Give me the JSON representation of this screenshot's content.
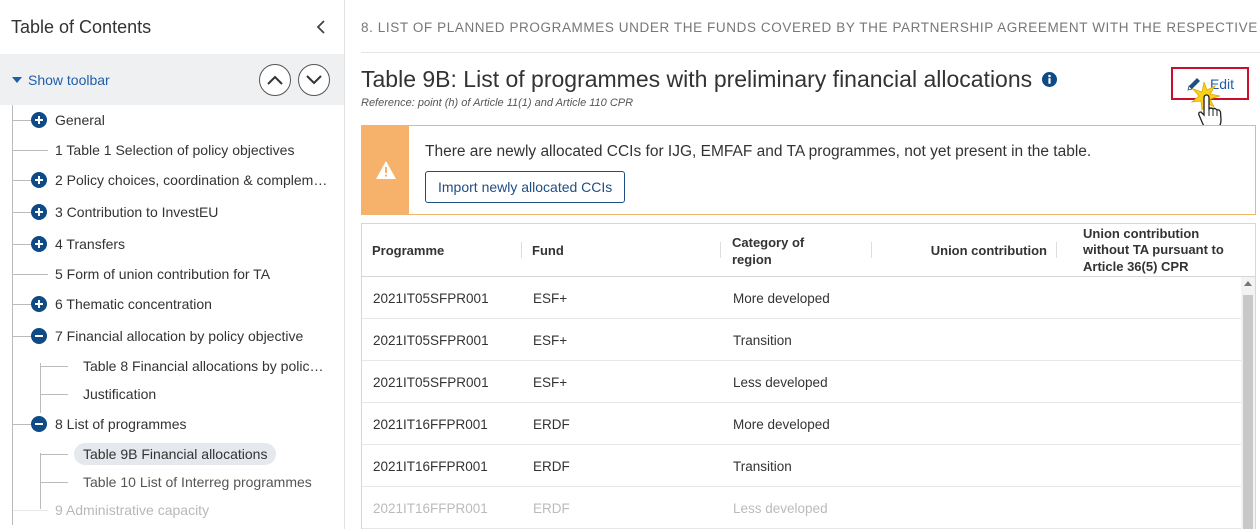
{
  "sidebar": {
    "title": "Table of Contents",
    "show_toolbar": "Show toolbar",
    "items": [
      {
        "label": "General",
        "icon": "plus"
      },
      {
        "label": "1 Table 1 Selection of policy objectives",
        "icon": "none"
      },
      {
        "label": "2 Policy choices, coordination & complem…",
        "icon": "plus"
      },
      {
        "label": "3 Contribution to InvestEU",
        "icon": "plus"
      },
      {
        "label": "4 Transfers",
        "icon": "plus"
      },
      {
        "label": "5 Form of union contribution for TA",
        "icon": "none"
      },
      {
        "label": "6 Thematic concentration",
        "icon": "plus"
      },
      {
        "label": "7 Financial allocation by policy objective",
        "icon": "minus"
      },
      {
        "label": "Table 8 Financial allocations by polic…",
        "icon": "none",
        "child": true
      },
      {
        "label": "Justification",
        "icon": "none",
        "child": true
      },
      {
        "label": "8 List of programmes",
        "icon": "minus"
      },
      {
        "label": "Table 9B Financial allocations",
        "icon": "none",
        "child": true,
        "selected": true
      },
      {
        "label": "Table 10 List of Interreg programmes",
        "icon": "none",
        "child": true
      },
      {
        "label": "9 Administrative capacity",
        "icon": "none"
      }
    ]
  },
  "main": {
    "breadcrumb": "8. LIST OF PLANNED PROGRAMMES UNDER THE FUNDS COVERED BY THE PARTNERSHIP AGREEMENT WITH THE RESPECTIVE",
    "title": "Table 9B: List of programmes with preliminary financial allocations",
    "subtitle": "Reference: point (h) of Article 11(1) and Article 110 CPR",
    "edit_label": "Edit",
    "alert_text": "There are newly allocated CCIs for IJG, EMFAF and TA programmes, not yet present in the table.",
    "import_label": "Import newly allocated CCIs",
    "table": {
      "headers": {
        "programme": "Programme",
        "fund": "Fund",
        "category": "Category of region",
        "union": "Union contribution",
        "union_ta": "Union contribution without TA pursuant to Article 36(5) CPR"
      },
      "rows": [
        {
          "programme": "2021IT05SFPR001",
          "fund": "ESF+",
          "category": "More developed"
        },
        {
          "programme": "2021IT05SFPR001",
          "fund": "ESF+",
          "category": "Transition"
        },
        {
          "programme": "2021IT05SFPR001",
          "fund": "ESF+",
          "category": "Less developed"
        },
        {
          "programme": "2021IT16FFPR001",
          "fund": "ERDF",
          "category": "More developed"
        },
        {
          "programme": "2021IT16FFPR001",
          "fund": "ERDF",
          "category": "Transition"
        },
        {
          "programme": "2021IT16FFPR001",
          "fund": "ERDF",
          "category": "Less developed"
        }
      ]
    }
  },
  "colors": {
    "accent": "#1f5fa8",
    "tree_icon": "#0e4b86",
    "alert": "#f6b26b",
    "edit_border": "#c8102e"
  }
}
